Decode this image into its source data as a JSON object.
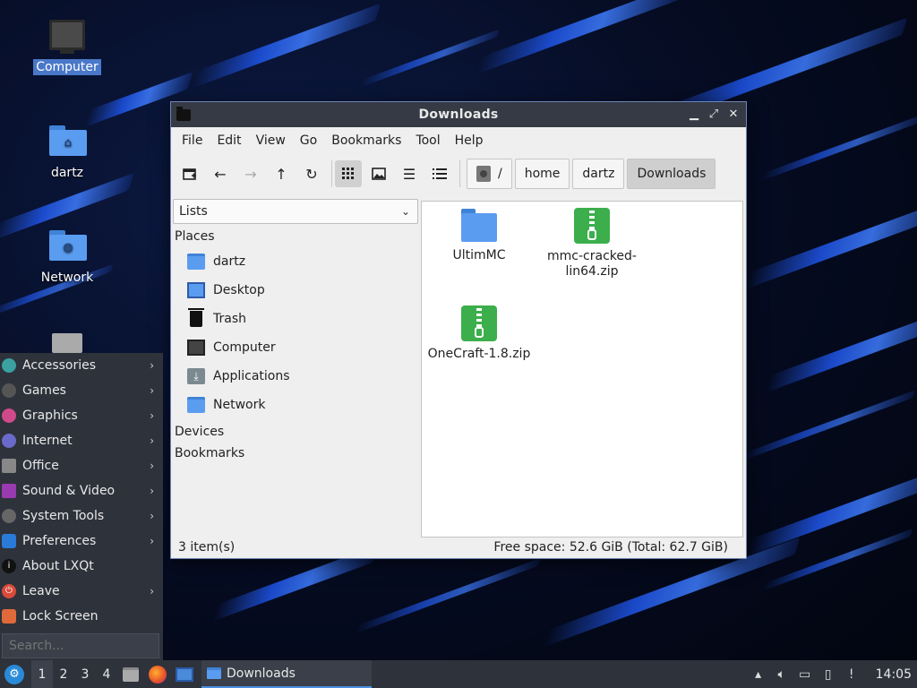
{
  "desktop": {
    "icons": [
      {
        "label": "Computer",
        "icon": "computer-icon",
        "selected": true
      },
      {
        "label": "dartz",
        "icon": "home-folder-icon"
      },
      {
        "label": "Network",
        "icon": "network-folder-icon"
      }
    ]
  },
  "window": {
    "title": "Downloads",
    "menu": [
      "File",
      "Edit",
      "View",
      "Go",
      "Bookmarks",
      "Tool",
      "Help"
    ],
    "toolbar": {
      "buttons": [
        "new-tab-icon",
        "back-icon",
        "forward-icon",
        "up-icon",
        "reload-icon",
        "icon-view-icon",
        "thumbnail-view-icon",
        "compact-view-icon",
        "detailed-list-icon"
      ]
    },
    "breadcrumb": [
      "/",
      "home",
      "dartz",
      "Downloads"
    ],
    "side_panel": {
      "mode": "Lists",
      "places_header": "Places",
      "places": [
        {
          "label": "dartz",
          "icon": "home-folder-icon"
        },
        {
          "label": "Desktop",
          "icon": "desktop-icon"
        },
        {
          "label": "Trash",
          "icon": "trash-icon"
        },
        {
          "label": "Computer",
          "icon": "computer-icon"
        },
        {
          "label": "Applications",
          "icon": "applications-icon"
        },
        {
          "label": "Network",
          "icon": "network-folder-icon"
        }
      ],
      "devices_header": "Devices",
      "bookmarks_header": "Bookmarks"
    },
    "files": [
      {
        "name": "UltimMC",
        "type": "folder"
      },
      {
        "name": "mmc-cracked-lin64.zip",
        "type": "zip",
        "line1": "mmc-cracked-",
        "line2": "lin64.zip"
      },
      {
        "name": "OneCraft-1.8.zip",
        "type": "zip"
      }
    ],
    "status": {
      "items": "3 item(s)",
      "free": "Free space: 52.6 GiB (Total: 62.7 GiB)"
    }
  },
  "start_menu": {
    "items": [
      {
        "label": "Accessories",
        "submenu": true,
        "color": "#3aa0a0"
      },
      {
        "label": "Games",
        "submenu": true,
        "color": "#555"
      },
      {
        "label": "Graphics",
        "submenu": true,
        "color": "#d04a8a"
      },
      {
        "label": "Internet",
        "submenu": true,
        "color": "#6a6aca"
      },
      {
        "label": "Office",
        "submenu": true,
        "color": "#888"
      },
      {
        "label": "Sound & Video",
        "submenu": true,
        "color": "#9a3ab0"
      },
      {
        "label": "System Tools",
        "submenu": true,
        "color": "#666"
      },
      {
        "label": "Preferences",
        "submenu": true,
        "color": "#2a7ad8"
      },
      {
        "label": "About LXQt",
        "submenu": false,
        "color": "#111"
      },
      {
        "label": "Leave",
        "submenu": true,
        "color": "#d84a3a"
      },
      {
        "label": "Lock Screen",
        "submenu": false,
        "color": "#e06a3a"
      }
    ],
    "search_placeholder": "Search..."
  },
  "taskbar": {
    "desktops": [
      "1",
      "2",
      "3",
      "4"
    ],
    "active_desktop": "1",
    "task_label": "Downloads",
    "clock": "14:05"
  }
}
